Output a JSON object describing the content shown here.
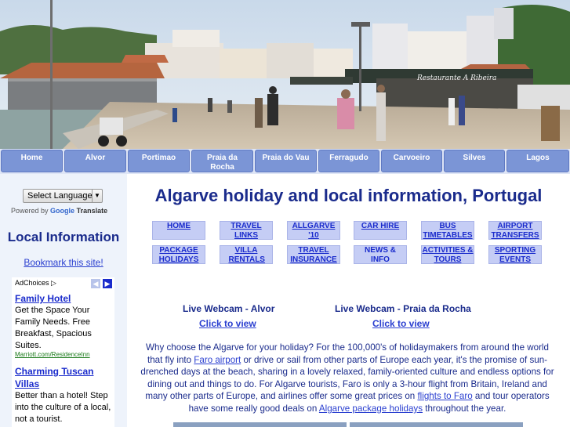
{
  "nav": {
    "items": [
      {
        "label": "Home"
      },
      {
        "label": "Alvor"
      },
      {
        "label": "Portimao"
      },
      {
        "label": "Praia da Rocha"
      },
      {
        "label": "Praia do Vau"
      },
      {
        "label": "Ferragudo"
      },
      {
        "label": "Carvoeiro"
      },
      {
        "label": "Silves"
      },
      {
        "label": "Lagos"
      }
    ]
  },
  "banner": {
    "sign_text": "Restaurante A Ribeira"
  },
  "sidebar": {
    "translate_select": "Select Language",
    "powered_by": "Powered by",
    "google": "Google",
    "translate": "Translate",
    "local_title": "Local Information",
    "bookmark": "Bookmark this site!",
    "ad": {
      "adchoices": "AdChoices",
      "items": [
        {
          "title": "Family Hotel",
          "body": "Get the Space Your Family Needs. Free Breakfast, Spacious Suites.",
          "url": "Marriott.com/ResidenceInn"
        },
        {
          "title": "Charming Tuscan Villas",
          "body": "Better than a hotel! Step into the culture of a local, not a tourist."
        }
      ]
    }
  },
  "main": {
    "title": "Algarve holiday and local information, Portugal",
    "quick_links": [
      {
        "label": "HOME"
      },
      {
        "label": "TRAVEL LINKS"
      },
      {
        "label": "ALLGARVE '10"
      },
      {
        "label": "CAR HIRE"
      },
      {
        "label": "BUS TIMETABLES"
      },
      {
        "label": "AIRPORT TRANSFERS"
      },
      {
        "label": "PACKAGE HOLIDAYS"
      },
      {
        "label": "VILLA RENTALS"
      },
      {
        "label": "TRAVEL INSURANCE"
      },
      {
        "label": "NEWS & INFO"
      },
      {
        "label": "ACTIVITIES & TOURS"
      },
      {
        "label": "SPORTING EVENTS"
      }
    ],
    "webcams": [
      {
        "heading": "Live Webcam - Alvor",
        "link": "Click to view"
      },
      {
        "heading": "Live Webcam - Praia da Rocha",
        "link": "Click to view"
      }
    ],
    "intro": {
      "t1": "Why choose the Algarve for your holiday? For the 100,000's of holidaymakers from around the world that fly into ",
      "l1": "Faro airport",
      "t2": " or drive or sail from other parts of Europe each year, it's the promise of sun-drenched days at the beach, sharing in a lovely relaxed, family-oriented culture and endless options for dining out and things to do. For Algarve tourists, Faro is only a 3-hour flight from Britain, Ireland and many other parts of Europe, and airlines offer some great prices on ",
      "l2": "flights to Faro",
      "t3": " and tour operators have some really good deals on ",
      "l3": "Algarve package holidays",
      "t4": " throughout the year."
    }
  }
}
